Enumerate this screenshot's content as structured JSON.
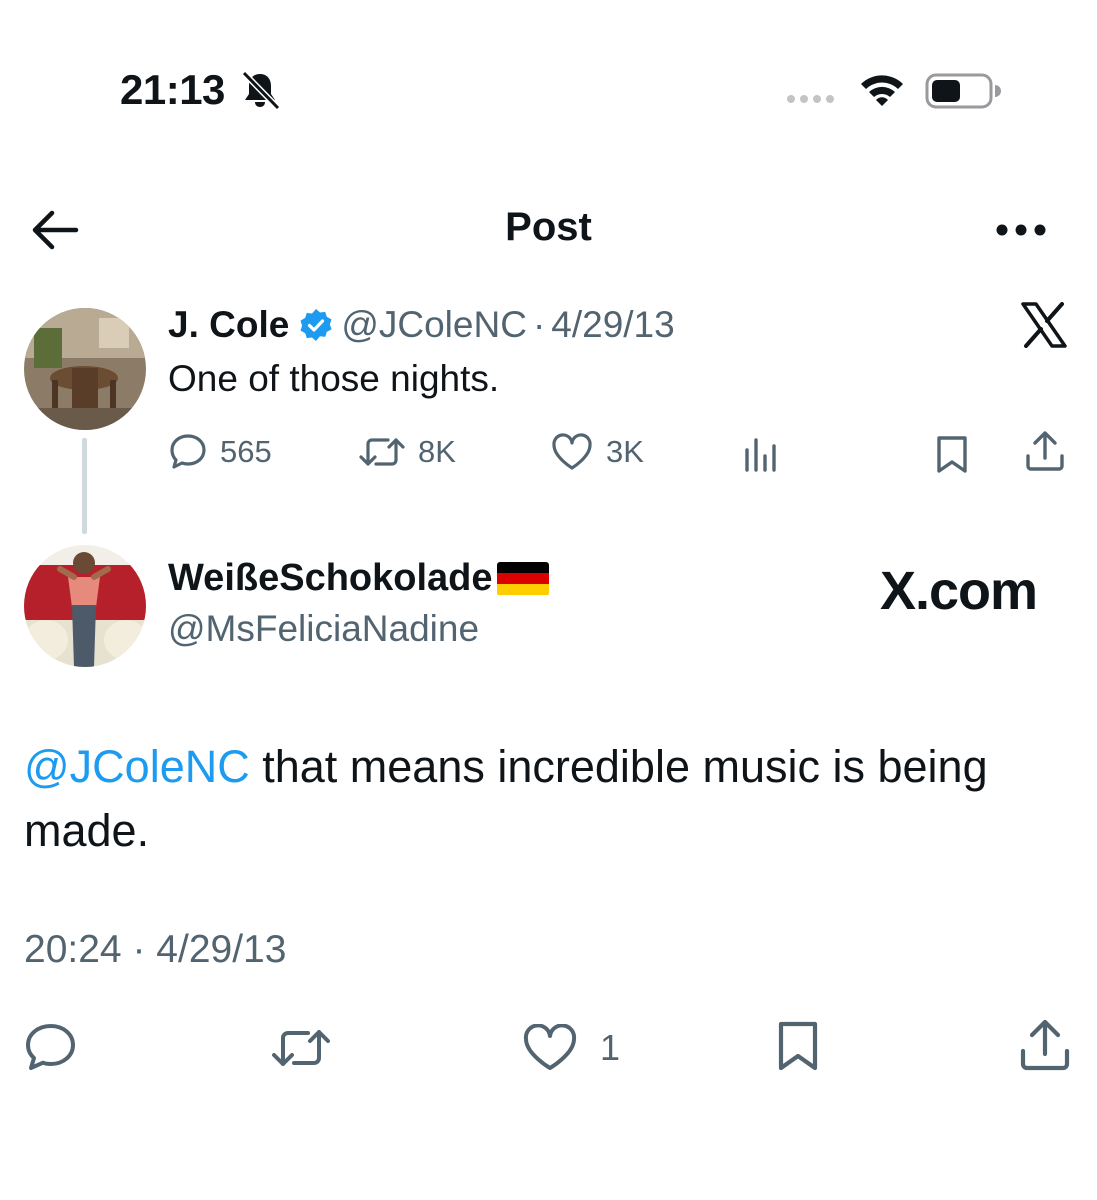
{
  "status_bar": {
    "time": "21:13",
    "icons": [
      "bell-slash-icon",
      "signal-icon",
      "wifi-icon",
      "battery-icon"
    ]
  },
  "header": {
    "title": "Post",
    "icons": [
      "back-arrow-icon",
      "more-icon"
    ]
  },
  "parent_post": {
    "name": "J. Cole",
    "handle": "@JColeNC",
    "separator": "·",
    "date": "4/29/13",
    "text": "One of those nights.",
    "replies": "565",
    "reposts": "8K",
    "likes": "3K",
    "icons": [
      "verified-badge-icon",
      "x-logo-icon",
      "reply-icon",
      "repost-icon",
      "like-icon",
      "views-icon",
      "bookmark-icon",
      "share-icon"
    ]
  },
  "reply_post": {
    "name": "WeißeSchokolade",
    "flag_icon": "germany-flag-icon",
    "handle": "@MsFeliciaNadine",
    "watermark": "X.com",
    "mention": "@JColeNC",
    "text": " that means incredible music is being made.",
    "time": "20:24",
    "separator": "·",
    "date": "4/29/13",
    "likes": "1",
    "icons": [
      "reply-icon",
      "repost-icon",
      "like-icon",
      "bookmark-icon",
      "share-icon"
    ]
  },
  "colors": {
    "text_primary": "#0f1419",
    "text_secondary": "#536471",
    "link": "#1d9bf0",
    "verified": "#1d9bf0",
    "thread_line": "#cfd9de"
  }
}
